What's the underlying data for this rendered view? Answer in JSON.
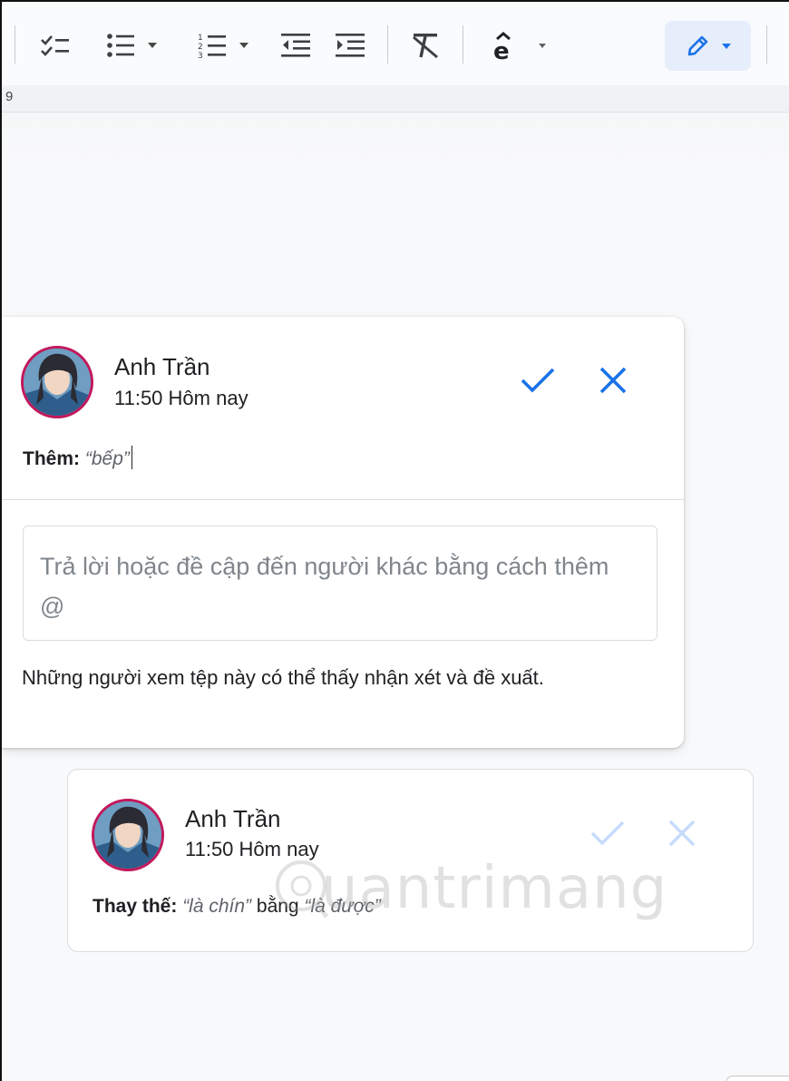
{
  "ruler": {
    "mark": "9"
  },
  "suggestions": [
    {
      "author": "Anh Trần",
      "time": "11:50 Hôm nay",
      "action_label": "Thêm:",
      "quoted_text": "“bếp”",
      "reply_placeholder": "Trả lời hoặc đề cập đến người khác bằng cách thêm @",
      "notice": "Những người xem tệp này có thể thấy nhận xét và đề xuất."
    },
    {
      "author": "Anh Trần",
      "time": "11:50 Hôm nay",
      "action_label": "Thay thế:",
      "old_text": "“là chín”",
      "connector": "bằng",
      "new_text": "“là được”"
    }
  ],
  "watermark": {
    "text": "uantrimang"
  },
  "colors": {
    "accent": "#1a73e8",
    "avatar_ring": "#c2185b",
    "toolbar_bg": "#f9fbfd",
    "pen_mode_bg": "#e7eefb"
  },
  "icons": {
    "checklist": "checklist-icon",
    "bulleted_list": "bulleted-list-icon",
    "numbered_list": "numbered-list-icon",
    "decrease_indent": "decrease-indent-icon",
    "increase_indent": "increase-indent-icon",
    "clear_formatting": "clear-formatting-icon",
    "input_tools": "input-tools-icon",
    "suggesting_mode": "pencil-icon",
    "accept": "check-icon",
    "reject": "close-icon"
  }
}
